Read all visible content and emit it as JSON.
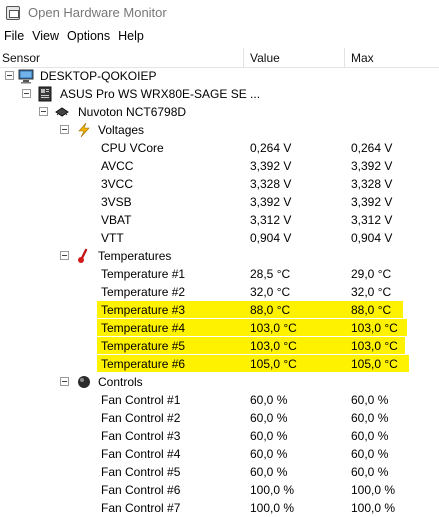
{
  "window": {
    "title": "Open Hardware Monitor"
  },
  "menu": {
    "file": "File",
    "view": "View",
    "options": "Options",
    "help": "Help"
  },
  "columns": {
    "sensor": "Sensor",
    "value": "Value",
    "max": "Max"
  },
  "tree": {
    "computer": "DESKTOP-QOKOIEP",
    "mainboard": "ASUS Pro WS WRX80E-SAGE SE ...",
    "chip": "Nuvoton NCT6798D",
    "voltages_label": "Voltages",
    "voltages": [
      {
        "name": "CPU VCore",
        "value": "0,264 V",
        "max": "0,264 V"
      },
      {
        "name": "AVCC",
        "value": "3,392 V",
        "max": "3,392 V"
      },
      {
        "name": "3VCC",
        "value": "3,328 V",
        "max": "3,328 V"
      },
      {
        "name": "3VSB",
        "value": "3,392 V",
        "max": "3,392 V"
      },
      {
        "name": "VBAT",
        "value": "3,312 V",
        "max": "3,312 V"
      },
      {
        "name": "VTT",
        "value": "0,904 V",
        "max": "0,904 V"
      }
    ],
    "temperatures_label": "Temperatures",
    "temperatures": [
      {
        "name": "Temperature #1",
        "value": "28,5 °C",
        "max": "29,0 °C"
      },
      {
        "name": "Temperature #2",
        "value": "32,0 °C",
        "max": "32,0 °C"
      },
      {
        "name": "Temperature #3",
        "value": "88,0 °C",
        "max": "88,0 °C"
      },
      {
        "name": "Temperature #4",
        "value": "103,0 °C",
        "max": "103,0 °C"
      },
      {
        "name": "Temperature #5",
        "value": "103,0 °C",
        "max": "103,0 °C"
      },
      {
        "name": "Temperature #6",
        "value": "105,0 °C",
        "max": "105,0 °C"
      }
    ],
    "controls_label": "Controls",
    "controls": [
      {
        "name": "Fan Control #1",
        "value": "60,0 %",
        "max": "60,0 %"
      },
      {
        "name": "Fan Control #2",
        "value": "60,0 %",
        "max": "60,0 %"
      },
      {
        "name": "Fan Control #3",
        "value": "60,0 %",
        "max": "60,0 %"
      },
      {
        "name": "Fan Control #4",
        "value": "60,0 %",
        "max": "60,0 %"
      },
      {
        "name": "Fan Control #5",
        "value": "60,0 %",
        "max": "60,0 %"
      },
      {
        "name": "Fan Control #6",
        "value": "100,0 %",
        "max": "100,0 %"
      },
      {
        "name": "Fan Control #7",
        "value": "100,0 %",
        "max": "100,0 %"
      }
    ]
  },
  "highlight_color": "#fff200"
}
